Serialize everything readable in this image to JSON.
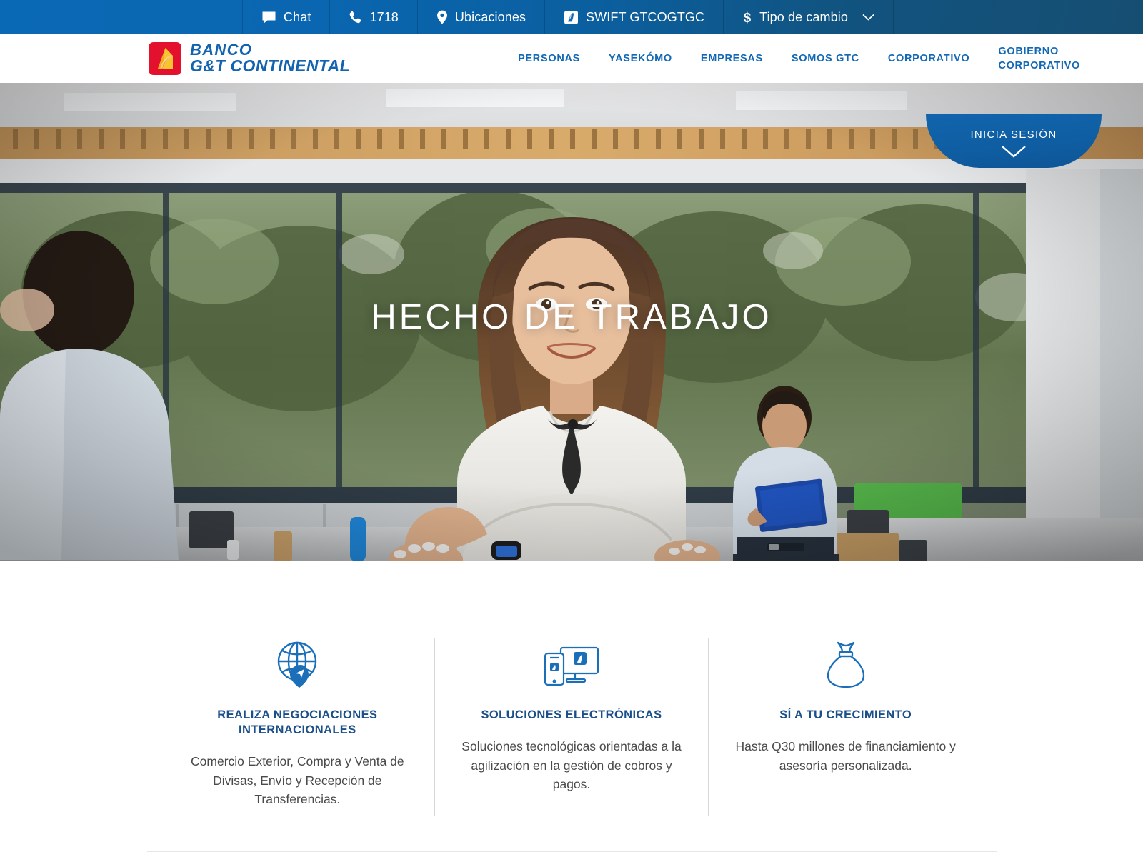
{
  "topbar": {
    "items": [
      {
        "label": "Chat",
        "icon": "chat-icon"
      },
      {
        "label": "1718",
        "icon": "phone-icon"
      },
      {
        "label": "Ubicaciones",
        "icon": "location-pin-icon"
      },
      {
        "label": "SWIFT GTCOGTGC",
        "icon": "swift-badge-icon"
      },
      {
        "label": "Tipo de cambio",
        "icon": "dollar-sign-icon",
        "caret": "chevron-down-icon"
      }
    ],
    "bg_left": "#0a69b5",
    "bg_right": "#164e72",
    "text_color": "#ffffff"
  },
  "header": {
    "logo": {
      "line1": "BANCO",
      "line2": "G&T CONTINENTAL",
      "mark_bg": "#e3112d",
      "mark_accent": "#f5c518",
      "text_color": "#1263b0"
    },
    "nav": [
      {
        "label": "PERSONAS"
      },
      {
        "label": "YASEKÓMO"
      },
      {
        "label": "EMPRESAS"
      },
      {
        "label": "SOMOS GTC"
      },
      {
        "label": "CORPORATIVO"
      },
      {
        "label": "GOBIERNO CORPORATIVO",
        "two_line": true
      }
    ],
    "nav_color": "#1268b5"
  },
  "login": {
    "label": "INICIA SESIÓN",
    "caret": "chevron-down-icon",
    "bg": "#1164ac"
  },
  "hero": {
    "title": "HECHO DE TRABAJO",
    "scene_description": "office-photo"
  },
  "features": [
    {
      "icon": "globe-pin-icon",
      "title": "REALIZA NEGOCIACIONES INTERNACIONALES",
      "description": "Comercio Exterior, Compra y Venta de Divisas, Envío y Recepción de Transferencias."
    },
    {
      "icon": "monitor-phone-icon",
      "title": "SOLUCIONES ELECTRÓNICAS",
      "description": "Soluciones tecnológicas orientadas a la agilización en la gestión de cobros y pagos."
    },
    {
      "icon": "money-bag-icon",
      "title": "SÍ A TU CRECIMIENTO",
      "description": "Hasta Q30 millones de financiamiento y asesoría personalizada."
    }
  ],
  "colors": {
    "brand_blue": "#1268b5",
    "brand_navy": "#1b4f8a",
    "brand_red": "#e3112d",
    "icon_blue": "#1b6fb8"
  }
}
